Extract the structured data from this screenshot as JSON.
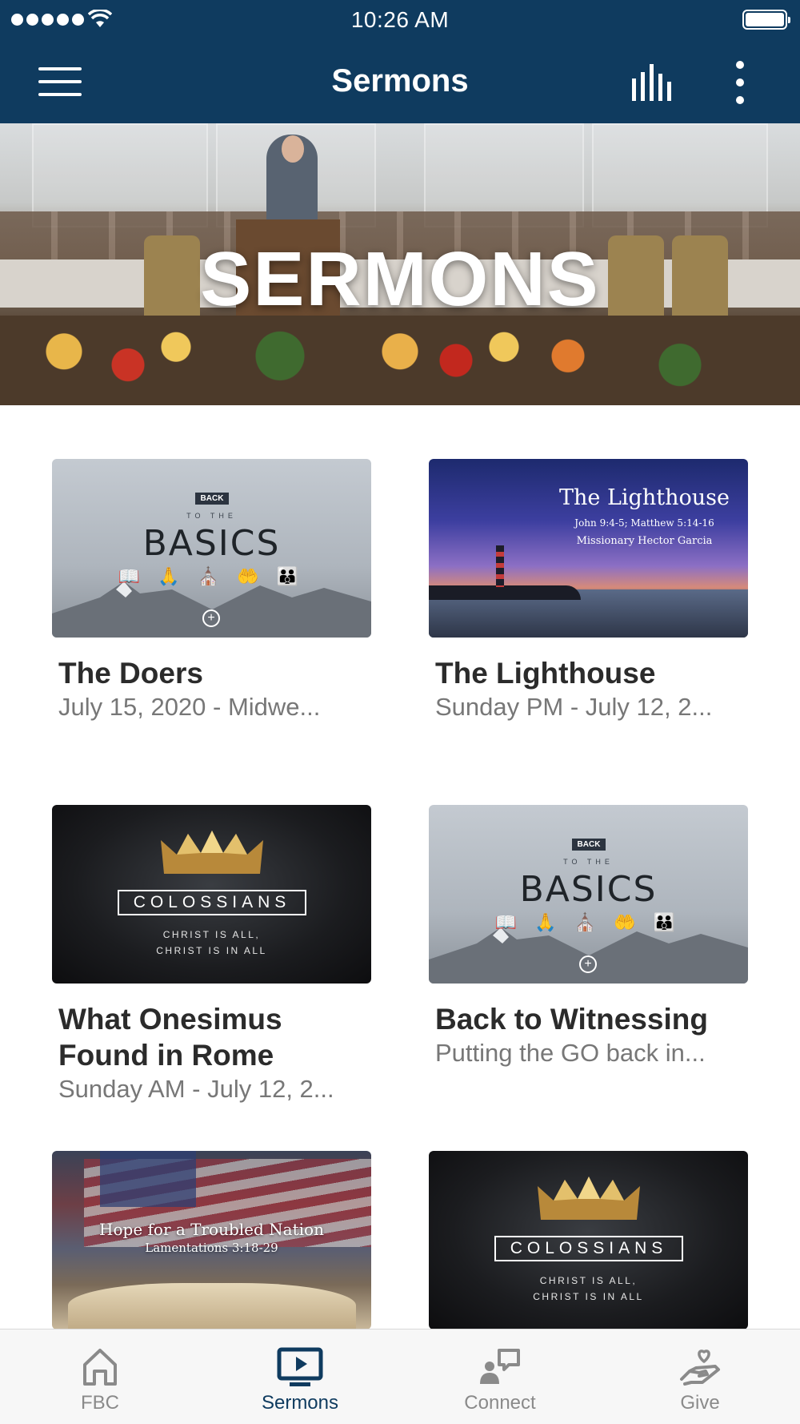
{
  "status_bar": {
    "time": "10:26 AM"
  },
  "header": {
    "title": "Sermons"
  },
  "hero": {
    "title": "SERMONS"
  },
  "sermons": [
    {
      "title": "The Doers",
      "subtitle": "July 15, 2020 - Midwe...",
      "thumb": "basics"
    },
    {
      "title": "The Lighthouse",
      "subtitle": "Sunday PM - July 12, 2...",
      "thumb": "lighthouse"
    },
    {
      "title": "What Onesimus Found in Rome",
      "subtitle": "Sunday AM - July 12, 2...",
      "thumb": "colossians"
    },
    {
      "title": "Back to Witnessing",
      "subtitle": "Putting the GO back in...",
      "thumb": "basics"
    },
    {
      "title": "",
      "subtitle": "",
      "thumb": "hope"
    },
    {
      "title": "",
      "subtitle": "",
      "thumb": "colossians"
    }
  ],
  "thumbs": {
    "basics": {
      "badge": "BACK",
      "small": "TO THE",
      "big": "BASICS",
      "icons": "📖 🙏 ⛪ 🤲 👪",
      "icon_names": [
        "bible-icon",
        "praying-hands-icon",
        "church-icon",
        "giving-hand-icon",
        "family-icon"
      ]
    },
    "lighthouse": {
      "title": "The Lighthouse",
      "ref": "John 9:4-5; Matthew 5:14-16",
      "speaker": "Missionary Hector Garcia"
    },
    "colossians": {
      "boxed": "COLOSSIANS",
      "tag1": "CHRIST IS ALL,",
      "tag2": "CHRIST IS IN ALL"
    },
    "hope": {
      "title": "Hope for a Troubled Nation",
      "ref": "Lamentations 3:18-29"
    }
  },
  "tabs": [
    {
      "label": "FBC",
      "icon": "home-icon",
      "active": false
    },
    {
      "label": "Sermons",
      "icon": "tv-play-icon",
      "active": true
    },
    {
      "label": "Connect",
      "icon": "connect-icon",
      "active": false
    },
    {
      "label": "Give",
      "icon": "give-icon",
      "active": false
    }
  ],
  "colors": {
    "header_bg": "#0f3b5f",
    "active_tab": "#0f3b5f",
    "inactive_tab": "#8a8a8a"
  }
}
